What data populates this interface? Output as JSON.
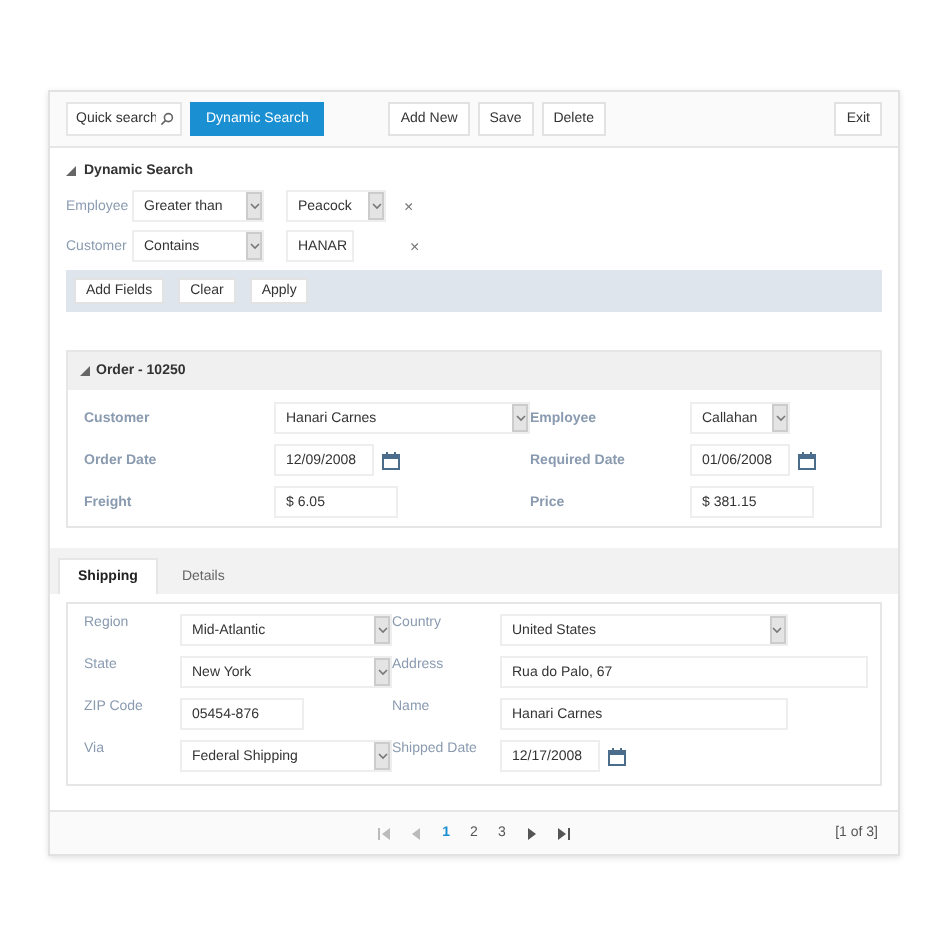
{
  "toolbar": {
    "quick_search": {
      "placeholder": "Quick search"
    },
    "search_button": "Dynamic Search",
    "actions": [
      "Add New",
      "Save",
      "Delete"
    ],
    "exit": "Exit"
  },
  "dynamic_search": {
    "title": "Dynamic Search",
    "expanded": true,
    "filters": [
      {
        "field": "Employee",
        "operator": "Greater than",
        "value": "Peacock",
        "kind": "dropdown",
        "remove": "×"
      },
      {
        "field": "Customer",
        "operator": "Contains",
        "value": "HANAR",
        "kind": "text",
        "remove": "×"
      }
    ],
    "buttons": [
      "Add Fields",
      "Clear",
      "Apply"
    ]
  },
  "order": {
    "title": "Order - 10250",
    "expanded": true,
    "fields": [
      {
        "label": "Customer",
        "value": "Hanari Carnes",
        "kind": "dropdown"
      },
      {
        "label": "Employee",
        "value": "Callahan",
        "kind": "dropdown"
      },
      {
        "label": "Order Date",
        "value": "12/09/2008",
        "kind": "date"
      },
      {
        "label": "Required Date",
        "value": "01/06/2008",
        "kind": "date"
      },
      {
        "label": "Freight",
        "value": "$ 6.05",
        "kind": "text"
      },
      {
        "label": "Price",
        "value": "$ 381.15",
        "kind": "text"
      }
    ]
  },
  "tabs": [
    {
      "label": "Shipping",
      "selected": true
    },
    {
      "label": "Details",
      "selected": false
    }
  ],
  "shipping": {
    "fields": [
      {
        "label": "Region",
        "value": "Mid-Atlantic",
        "kind": "dropdown"
      },
      {
        "label": "Country",
        "value": "United States",
        "kind": "dropdown"
      },
      {
        "label": "State",
        "value": "New York",
        "kind": "dropdown"
      },
      {
        "label": "Address",
        "value": "Rua do Palo, 67",
        "kind": "text"
      },
      {
        "label": "ZIP Code",
        "value": "05454-876",
        "kind": "text"
      },
      {
        "label": "Name",
        "value": "Hanari Carnes",
        "kind": "text"
      },
      {
        "label": "Via",
        "value": "Federal Shipping",
        "kind": "dropdown"
      },
      {
        "label": "Shipped Date",
        "value": "12/17/2008",
        "kind": "date"
      }
    ]
  },
  "pager": {
    "pages": [
      {
        "label": "1",
        "selected": true
      },
      {
        "label": "2",
        "selected": false
      },
      {
        "label": "3",
        "selected": false
      }
    ],
    "summary": "[1 of 3]"
  }
}
